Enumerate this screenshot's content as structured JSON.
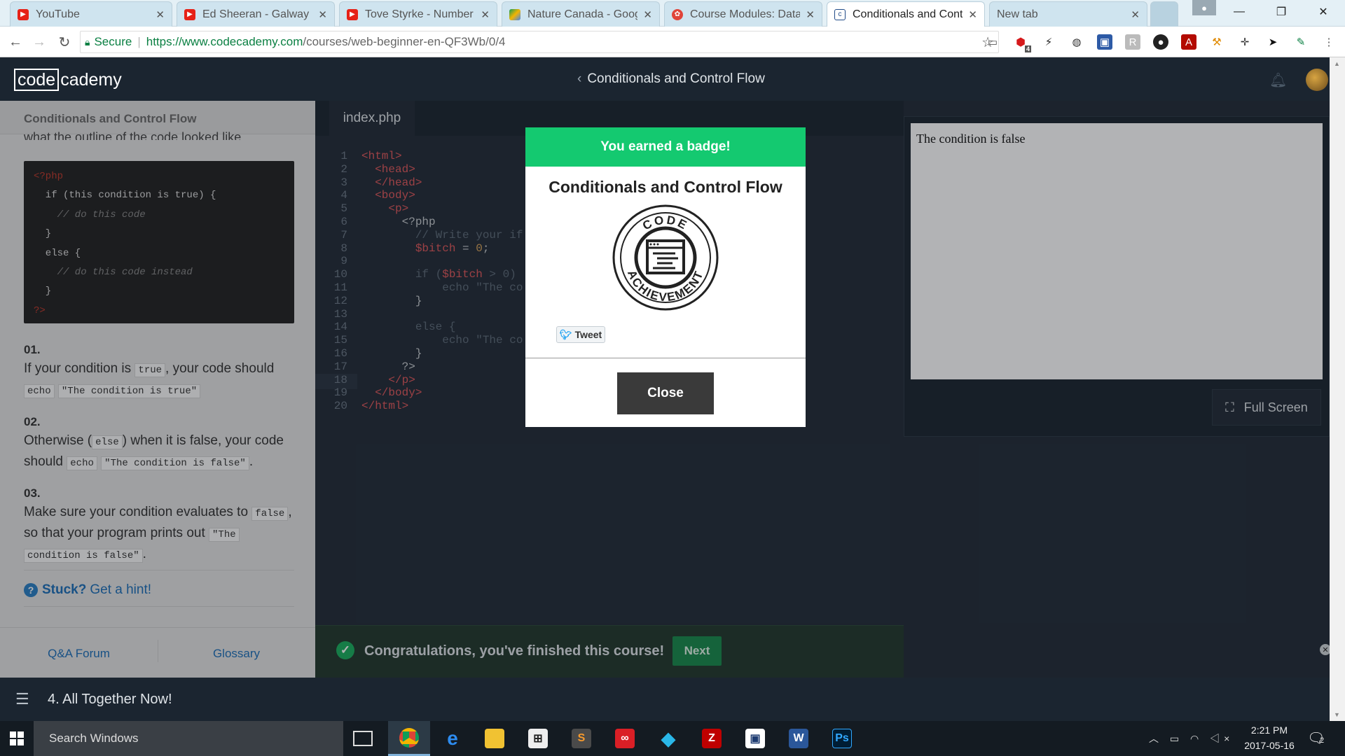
{
  "browser": {
    "tabs": [
      {
        "title": "YouTube",
        "icon": "youtube-icon",
        "color": "#e62117"
      },
      {
        "title": "Ed Sheeran - Galway Gi",
        "icon": "youtube-icon",
        "color": "#e62117"
      },
      {
        "title": "Tove Styrke - Number C",
        "icon": "youtube-icon",
        "color": "#e62117"
      },
      {
        "title": "Nature Canada - Googl",
        "icon": "google-drive-icon",
        "color": "#f4b400"
      },
      {
        "title": "Course Modules: Datab",
        "icon": "course-icon",
        "color": "#e0443a"
      },
      {
        "title": "Conditionals and Contr",
        "icon": "codecademy-icon",
        "color": "#204a87"
      },
      {
        "title": "New tab",
        "icon": "",
        "color": ""
      }
    ],
    "secure_label": "Secure",
    "url_host": "https://www.codecademy.com",
    "url_path": "/courses/web-beginner-en-QF3Wb/0/4",
    "ext_badge": "4"
  },
  "app": {
    "logo_left": "code",
    "logo_right": "cademy",
    "lesson_title": "Conditionals and Control Flow"
  },
  "instructions": {
    "header": "Conditionals and Control Flow",
    "cut_line": "what the outline of the code looked like.",
    "code": [
      "<?php",
      "  if (this condition is true) {",
      "    // do this code",
      "  }",
      "  else {",
      "    // do this code instead",
      "  }",
      "?>"
    ],
    "steps": [
      {
        "num": "01.",
        "t1": "If your condition is ",
        "c1": "true",
        "t2": ", your code should ",
        "c2": "echo",
        "c3": "\"The condition is true\""
      },
      {
        "num": "02.",
        "t1": "Otherwise (",
        "c1": "else",
        "t2": ") when it is false, your code should ",
        "c2": "echo",
        "c3": "\"The condition is false\"",
        "end": "."
      },
      {
        "num": "03.",
        "t1": "Make sure your condition evaluates to ",
        "c1": "false",
        "t2": ", so that your program prints out ",
        "c3a": "\"The",
        "c3b": "condition is false\"",
        "end": "."
      }
    ],
    "stuck": "Stuck?",
    "hint": "Get a hint!",
    "qa": "Q&A Forum",
    "glossary": "Glossary"
  },
  "editor": {
    "file_tab": "index.php",
    "lines": [
      [
        [
          "<html>",
          "#e0575b"
        ]
      ],
      [
        [
          "  <head>",
          "#e0575b"
        ]
      ],
      [
        [
          "  </head>",
          "#e0575b"
        ]
      ],
      [
        [
          "  <body>",
          "#e0575b"
        ]
      ],
      [
        [
          "    <p>",
          "#e0575b"
        ]
      ],
      [
        [
          "      <?php",
          "#c8ccd0"
        ]
      ],
      [
        [
          "        // Write your if",
          "#5d6a78"
        ]
      ],
      [
        [
          "        $bitch",
          "#e0575b"
        ],
        [
          " = ",
          "#c8ccd0"
        ],
        [
          "0",
          "#d9a35a"
        ],
        [
          ";",
          "#c8ccd0"
        ]
      ],
      [
        [
          "",
          "#c8ccd0"
        ]
      ],
      [
        [
          "        if (",
          "#5d6a78"
        ],
        [
          "$bitch",
          "#e0575b"
        ],
        [
          " > 0) ",
          "#5d6a78"
        ]
      ],
      [
        [
          "            echo \"The co",
          "#5d6a78"
        ]
      ],
      [
        [
          "        }",
          "#c8ccd0"
        ]
      ],
      [
        [
          "",
          "#c8ccd0"
        ]
      ],
      [
        [
          "        else {",
          "#5d6a78"
        ]
      ],
      [
        [
          "            echo \"The co",
          "#5d6a78"
        ]
      ],
      [
        [
          "        }",
          "#c8ccd0"
        ]
      ],
      [
        [
          "      ?>",
          "#c8ccd0"
        ]
      ],
      [
        [
          "    </p>",
          "#e0575b"
        ]
      ],
      [
        [
          "  </body>",
          "#e0575b"
        ]
      ],
      [
        [
          "</html>",
          "#e0575b"
        ]
      ]
    ]
  },
  "output": {
    "text": "The condition is false",
    "fullscreen": "Full Screen"
  },
  "modal": {
    "banner": "You earned a badge!",
    "title": "Conditionals and Control Flow",
    "badge_top": "CODE",
    "badge_bottom": "ACHIEVEMENT",
    "tweet": "Tweet",
    "close": "Close"
  },
  "notice": {
    "text": "Congratulations, you've finished this course!",
    "next": "Next"
  },
  "bottom": {
    "unit": "4. All Together Now!"
  },
  "taskbar": {
    "search": "Search Windows",
    "time": "2:21 PM",
    "date": "2017-05-16",
    "notif_count": "2"
  }
}
